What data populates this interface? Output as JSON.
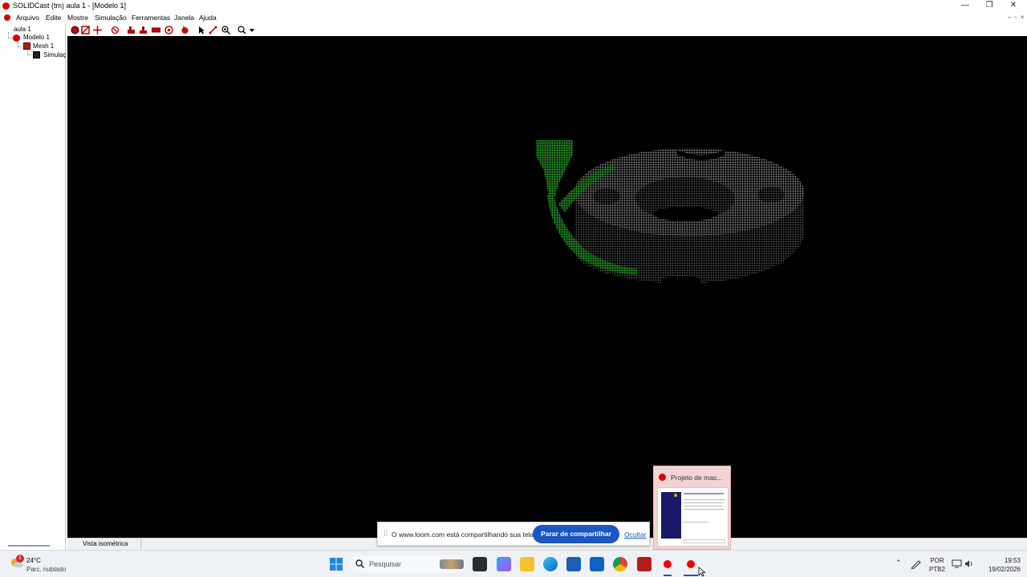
{
  "window": {
    "title": "SOLIDCast (tm) aula 1 - [Modelo 1]",
    "controls": {
      "minimize": "—",
      "restore": "❐",
      "close": "✕"
    },
    "mdi_controls": {
      "minimize": "–",
      "restore": "▫",
      "close": "×"
    }
  },
  "menu": {
    "items": [
      "Arquivo",
      "Edite",
      "Mostre",
      "Simulação",
      "Ferramentas",
      "Janela",
      "Ajuda"
    ]
  },
  "tree": {
    "root": "aula 1",
    "model": "Modelo 1",
    "mesh": "Mesh 1",
    "simulation": "Simulaç"
  },
  "toolbar": {
    "icons": [
      "model-icon",
      "shape-icon",
      "move-icon",
      "rotate-icon",
      "riser-icon",
      "chill-icon",
      "box-icon",
      "cylinder-icon",
      "pour-icon",
      "pointer-icon",
      "measure-icon",
      "zoom-icon",
      "zoom-menu-icon"
    ]
  },
  "viewport": {
    "background": "#000000",
    "part_color": "#7a7a7a",
    "gating_color": "#1f8a1f"
  },
  "status": {
    "view_label": "Vista isométrica"
  },
  "share_bar": {
    "grip": "⁞⁞",
    "message": "O www.loom.com está compartilhando sua tela.",
    "stop_label": "Parar de compartilhar",
    "hide_label": "Ocultar",
    "accent": "#1a56c4"
  },
  "preview": {
    "title": "Projeto de mas..."
  },
  "taskbar": {
    "weather_temp": "24°C",
    "weather_desc": "Parc. nublado",
    "weather_badge": "1",
    "search_placeholder": "Pesquisar",
    "lang_top": "POR",
    "lang_bottom": "PTB2",
    "time": "19:53",
    "date": "19/02/2026"
  }
}
